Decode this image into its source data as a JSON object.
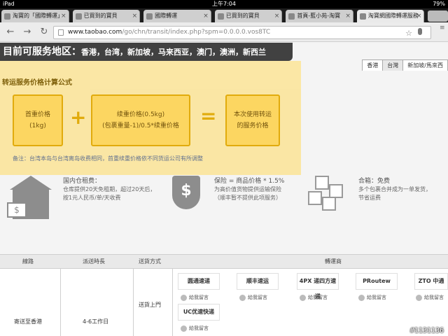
{
  "status_bar": {
    "device": "iPad",
    "time": "上午7:04",
    "battery": "79%"
  },
  "tabs": [
    {
      "label": "淘寶的「國際轉運」",
      "active": false
    },
    {
      "label": "已買到的寶貝",
      "active": false
    },
    {
      "label": "國際轉運",
      "active": false
    },
    {
      "label": "已買到的寶貝",
      "active": false
    },
    {
      "label": "首頁-藍小苑-淘寶",
      "active": false
    },
    {
      "label": "淘寶網國際轉運服務",
      "active": true
    }
  ],
  "address_bar": {
    "host": "www.taobao.com",
    "path": "/go/chn/transit/index.php?spm=0.0.0.0.vos8TC"
  },
  "banner": {
    "prefix": "目前可服务地区：",
    "regions": "香港，台湾，新加坡，马来西亚，澳门，澳洲，新西兰"
  },
  "region_tabs": [
    {
      "label": "香港",
      "active": false
    },
    {
      "label": "台灣",
      "active": true
    },
    {
      "label": "新加坡/馬來西",
      "active": false
    }
  ],
  "calc": {
    "title": "转运服务价格计算公式",
    "box1_line1": "首重价格",
    "box1_line2": "(1kg)",
    "box2_line1": "续重价格(0.5kg)",
    "box2_line2": "(包裹重量-1)/0.5*续重价格",
    "box3_line1": "本次使用转运",
    "box3_line2": "的服务价格",
    "plus": "+",
    "equals": "=",
    "note": "备注：台湾本岛与台湾离岛收费相同，首重续重价格依不同货运公司有所调整"
  },
  "features": {
    "storage_title": "国内仓租费：",
    "storage_line1": "仓库提供20天免租期，超过20天后，",
    "storage_line2": "按1元人民币/单/天收费",
    "insurance_title": "保险 = 商品价格 * 1.5%",
    "insurance_line1": "为高价值货物提供运输保险",
    "insurance_line2": "（顺丰暂不提供此项服务）",
    "merge_title": "合箱：免费",
    "merge_line1": "多个包裹合并成为一单发货，",
    "merge_line2": "节省运费"
  },
  "table": {
    "headers": {
      "route": "線路",
      "time": "派送時長",
      "method": "送貨方式",
      "carrier": "轉運商"
    },
    "route": "寄送至香港",
    "time": "4-6工作日",
    "method": "送貨上門",
    "carriers": [
      "圆通速递",
      "顺丰速运",
      "4PX 递四方速递",
      "PRoutew",
      "ZTO 中通",
      "UC优速快递"
    ],
    "message_label": "給我留言"
  },
  "watermark": "#1131136"
}
